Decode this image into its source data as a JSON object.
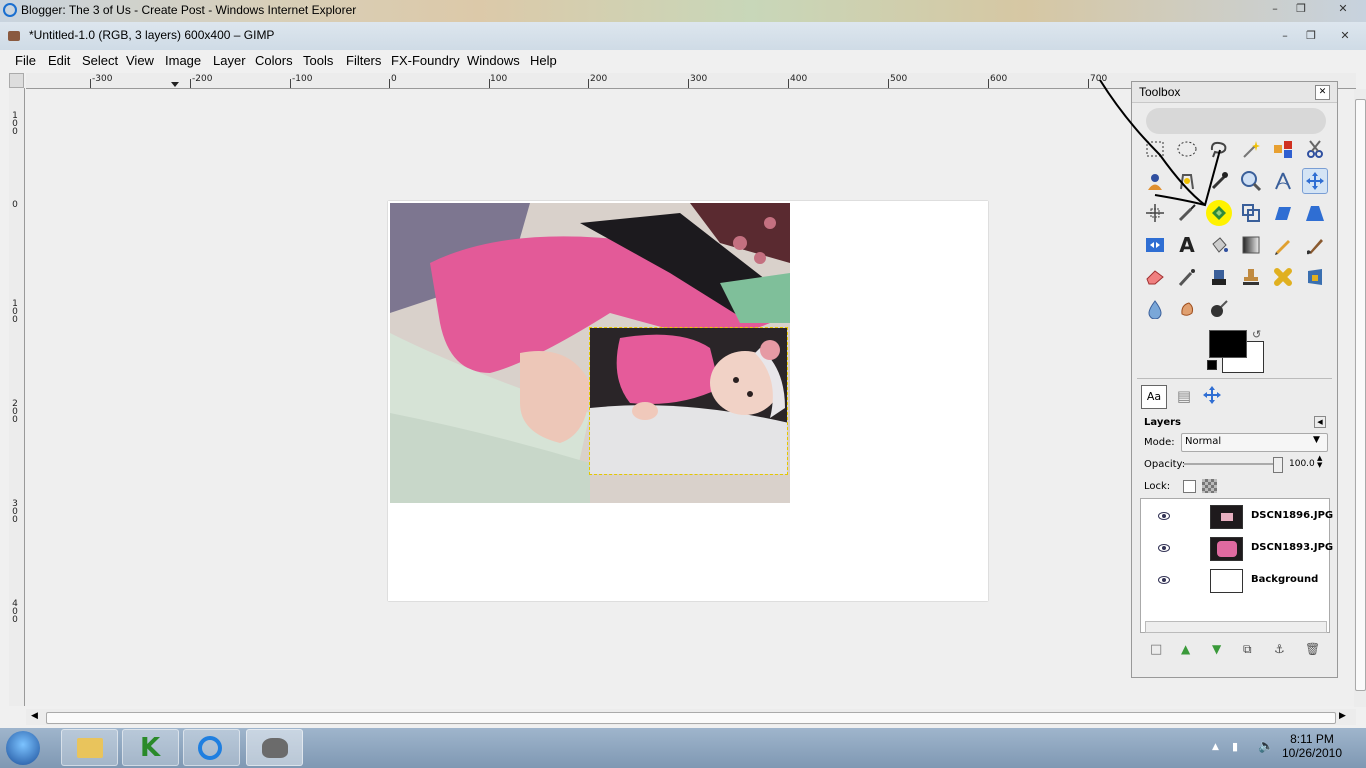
{
  "ie_window": {
    "title": "Blogger: The 3 of Us - Create Post - Windows Internet Explorer"
  },
  "gimp_window": {
    "title": "*Untitled-1.0 (RGB, 3 layers) 600x400 – GIMP"
  },
  "menu": [
    {
      "label": "File"
    },
    {
      "label": "Edit"
    },
    {
      "label": "Select"
    },
    {
      "label": "View"
    },
    {
      "label": "Image"
    },
    {
      "label": "Layer"
    },
    {
      "label": "Colors"
    },
    {
      "label": "Tools"
    },
    {
      "label": "Filters"
    },
    {
      "label": "FX-Foundry"
    },
    {
      "label": "Windows"
    },
    {
      "label": "Help"
    }
  ],
  "hruler": [
    "-300",
    "-200",
    "-100",
    "0",
    "100",
    "200",
    "300",
    "400",
    "500",
    "600",
    "700"
  ],
  "vruler": [
    "100",
    "200",
    "300",
    "400"
  ],
  "toolbox": {
    "title": "Toolbox",
    "tools": [
      "rect-select-icon",
      "ellipse-select-icon",
      "free-select-icon",
      "fuzzy-select-icon",
      "color-select-icon",
      "scissors-icon",
      "foreground-select-icon",
      "paths-icon",
      "color-picker-icon",
      "zoom-icon",
      "measure-icon",
      "move-icon",
      "align-icon",
      "crop-icon",
      "rotate-icon",
      "scale-icon",
      "shear-icon",
      "perspective-icon",
      "flip-icon",
      "text-icon",
      "bucket-fill-icon",
      "blend-icon",
      "pencil-icon",
      "paintbrush-icon",
      "eraser-icon",
      "airbrush-icon",
      "ink-icon",
      "clone-icon",
      "heal-icon",
      "perspective-clone-icon",
      "blur-icon",
      "smudge-icon",
      "dodge-burn-icon"
    ],
    "active_tool": "move-icon",
    "highlighted_tool": "rotate-icon",
    "fg_color": "#000000",
    "bg_color": "#ffffff"
  },
  "layers": {
    "title": "Layers",
    "mode_label": "Mode:",
    "mode_value": "Normal",
    "opacity_label": "Opacity:",
    "opacity_value": "100.0",
    "lock_label": "Lock:",
    "items": [
      {
        "name": "DSCN1896.JPG"
      },
      {
        "name": "DSCN1893.JPG"
      },
      {
        "name": "Background"
      }
    ]
  },
  "taskbar": {
    "time": "8:11 PM",
    "date": "10/26/2010"
  }
}
